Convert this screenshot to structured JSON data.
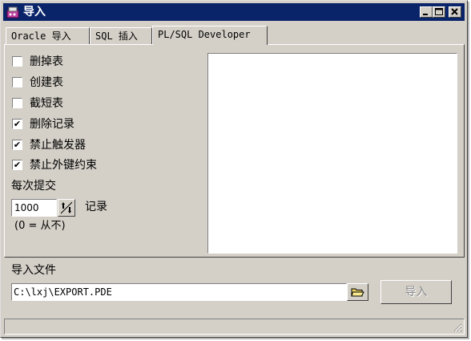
{
  "window": {
    "title": "导入"
  },
  "tabs": [
    {
      "label": "Oracle 导入"
    },
    {
      "label": "SQL 插入"
    },
    {
      "label": "PL/SQL Developer"
    }
  ],
  "options": [
    {
      "label": "删掉表",
      "checked": false
    },
    {
      "label": "创建表",
      "checked": false
    },
    {
      "label": "截短表",
      "checked": false
    },
    {
      "label": "删除记录",
      "checked": true
    },
    {
      "label": "禁止触发器",
      "checked": true
    },
    {
      "label": "禁止外键约束",
      "checked": true
    }
  ],
  "commit": {
    "label": "每次提交",
    "value": "1000",
    "unit": "记录",
    "note": "(0 = 从不)"
  },
  "file": {
    "label": "导入文件",
    "value": "C:\\lxj\\EXPORT.PDE"
  },
  "import_button": {
    "label": "导入"
  },
  "check_mark": "✔",
  "colors": {
    "titlebar": "#0a246a",
    "face": "#d4d0c8",
    "disabled_text": "#8a8a8a"
  }
}
